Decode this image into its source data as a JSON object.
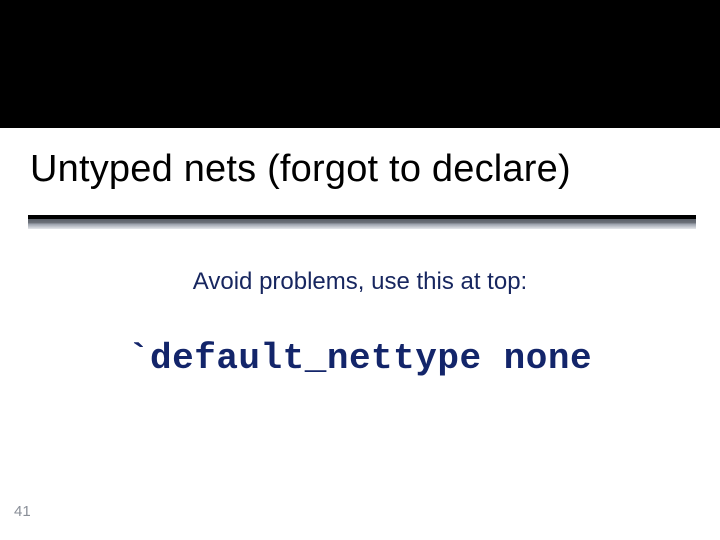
{
  "slide": {
    "title": "Untyped nets (forgot to declare)",
    "subtitle": "Avoid problems, use this at top:",
    "code": "`default_nettype none",
    "page_number": "41"
  }
}
